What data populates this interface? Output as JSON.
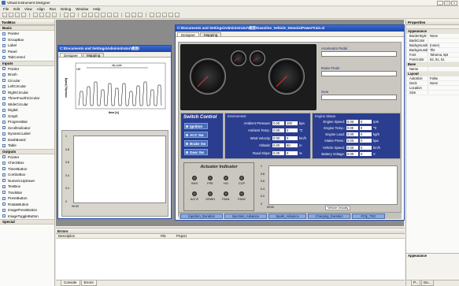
{
  "window": {
    "title": "Virtual Instrument Designer"
  },
  "menu": [
    "File",
    "Edit",
    "View",
    "Align",
    "Run",
    "Debug",
    "Window",
    "Help"
  ],
  "toolbox": {
    "title": "ToolBox",
    "groups": [
      {
        "name": "Basic",
        "items": [
          "Pointer",
          "GroupBox",
          "Label",
          "Panel",
          "TabControl"
        ]
      },
      {
        "name": "Inputs",
        "items": [
          "Pointer",
          "Brush",
          "Circular",
          "LeftCircular",
          "RightCircular",
          "ThreeFourthCircular",
          "WideCircular",
          "Digital",
          "Graph",
          "ProgressBar",
          "ScrollIndicator",
          "DynamicLabel",
          "DashBoard",
          "Table"
        ]
      },
      {
        "name": "Outputs",
        "items": [
          "Pointer",
          "CheckBox",
          "TimerButton",
          "ComboBox",
          "NumericUpDown",
          "TextBox",
          "TrackBar",
          "PressButton",
          "RotateButton",
          "ImagePressButton",
          "ImageToggleButton"
        ]
      },
      {
        "name": "Special",
        "items": []
      }
    ]
  },
  "back_window": {
    "title": "C:\\Documents and Settings\\Administrator\\桌面\\",
    "tabs": [
      "Designer",
      "Mapping"
    ],
    "chart": {
      "title": "city cycle",
      "xlabel": "time [s]",
      "ylabel": "velocity [km/h]",
      "value": "180"
    },
    "lower_chart": {
      "ticks": [
        "1",
        "0.8",
        "0.6",
        "0.4",
        "0.2",
        "0"
      ],
      "xlabel": "00:00"
    }
  },
  "main_window": {
    "title": "C:\\Documents and Settings\\Administrator\\桌面\\Gasoline_Vehicle_Demo\\x\\PowerTrain.vi",
    "tabs": [
      "Designer",
      "Mapping"
    ]
  },
  "pedals": [
    {
      "label": "Accelerator Pedal"
    },
    {
      "label": "Brake Pedal"
    },
    {
      "label": "Gear"
    }
  ],
  "switch_control": {
    "title": "Switch Control",
    "buttons": [
      "Ignition",
      "ACC Sw",
      "Brake Sw",
      "Gear Sw"
    ]
  },
  "environment": {
    "title": "Environment",
    "rows": [
      {
        "label": "Ambient Pressure:",
        "value": "0.00",
        "value2": "100",
        "unit": "kpa"
      },
      {
        "label": "Ambient Temp.:",
        "value": "0.00",
        "value2": "0",
        "unit": "℃"
      },
      {
        "label": "Wind Velocity:",
        "value": "0.00",
        "value2": "0",
        "unit": "km/h"
      },
      {
        "label": "Altitude:",
        "value": "0.00",
        "value2": "50",
        "unit": "m"
      },
      {
        "label": "Road Slope:",
        "value": "0.00",
        "value2": "0",
        "unit": "%"
      }
    ]
  },
  "engine_status": {
    "title": "Engine Status",
    "rows": [
      {
        "label": "Engine Speed:",
        "value": "0.00",
        "value2": "0",
        "unit": "rpm"
      },
      {
        "label": "Engine Temp.:",
        "value": "0.00",
        "value2": "0",
        "unit": "℃"
      },
      {
        "label": "Engine Load:",
        "value": "0.00",
        "value2": "0",
        "unit": "kg/h"
      },
      {
        "label": "Intake Press.:",
        "value": "0.00",
        "value2": "0",
        "unit": "kpa"
      },
      {
        "label": "Vehicle Speed:",
        "value": "0.00",
        "value2": "0",
        "unit": "km/h"
      },
      {
        "label": "Battery Voltage:",
        "value": "0.00",
        "value2": "0",
        "unit": "V"
      }
    ]
  },
  "actuator": {
    "title": "Actuator Indicator",
    "leds": [
      "INHI",
      "FPE",
      "HO",
      "CCP",
      "A/C R",
      "OSWH",
      "FAN1",
      "FAN2"
    ]
  },
  "velocity_plot": {
    "label": "Vehicle Velocity",
    "ticks": [
      "1",
      "0.8",
      "0.6",
      "0.4",
      "0.2",
      "0"
    ],
    "xlabel": "00:00"
  },
  "bottom_tabs": [
    "Injection_Duration",
    "Injection_Advance",
    "Spark_Advance",
    "Charging_Duration",
    "#Cly_TDC"
  ],
  "errors": {
    "title": "Errors",
    "columns": [
      "Description",
      "File",
      "Project"
    ],
    "tabs": [
      "Console",
      "Errors"
    ]
  },
  "properties": {
    "title": "Properties",
    "categories": [
      {
        "name": "Appearance",
        "rows": [
          [
            "BorderStyle",
            "None"
          ],
          [
            "BackColor",
            ""
          ],
          [
            "BackgroundImage",
            "(none)"
          ],
          [
            "BackgroundImageLayout",
            "Tile"
          ],
          [
            "Font",
            "Tahoma, 8pt"
          ],
          [
            "ForeColor",
            "52, 51, 51"
          ]
        ]
      },
      {
        "name": "Base",
        "rows": [
          [
            "Name",
            ""
          ]
        ]
      },
      {
        "name": "Layout",
        "rows": [
          [
            "AutoSize",
            "False"
          ],
          [
            "Dock",
            "None"
          ],
          [
            "Location",
            ""
          ],
          [
            "Size",
            ""
          ]
        ]
      }
    ],
    "footer": "Appearance",
    "bottom_tabs": [
      "P...",
      "Do..."
    ]
  }
}
